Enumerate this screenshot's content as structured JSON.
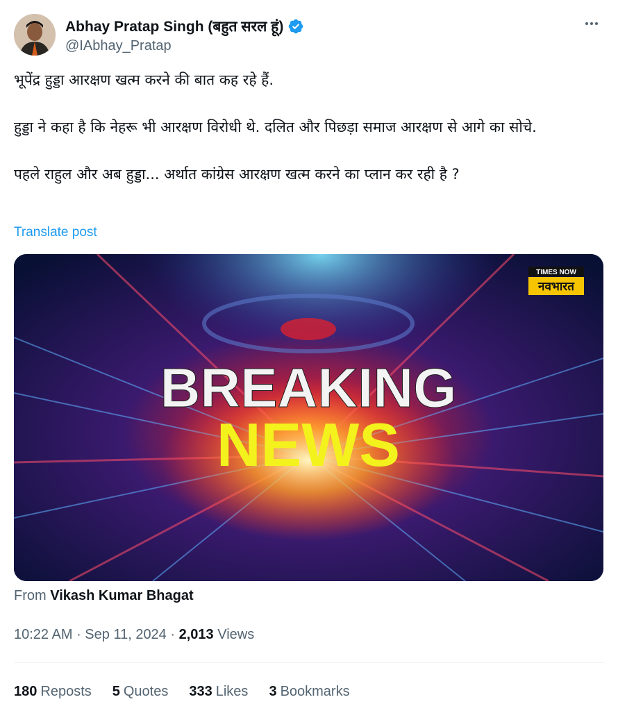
{
  "author": {
    "display_name": "Abhay Pratap Singh (बहुत सरल हूं)",
    "handle": "@IAbhay_Pratap",
    "verified_color": "#1d9bf0"
  },
  "post": {
    "paragraphs": [
      "भूपेंद्र हुड्डा आरक्षण खत्म करने की बात कह रहे हैं.",
      "हुड्डा ने कहा है कि नेहरू भी आरक्षण विरोधी थे. दलित और पिछड़ा समाज आरक्षण से आगे का सोचे.",
      "पहले राहुल और अब हुड्डा... अर्थात कांग्रेस आरक्षण खत्म करने का प्लान कर रही है ?"
    ],
    "translate_label": "Translate post"
  },
  "media": {
    "channel_top": "TIMES NOW",
    "channel_bottom": "नवभारत",
    "headline_line1": "BREAKING",
    "headline_line2": "NEWS"
  },
  "attribution": {
    "prefix": "From",
    "name": "Vikash Kumar Bhagat"
  },
  "meta": {
    "time": "10:22 AM",
    "date": "Sep 11, 2024",
    "views_count": "2,013",
    "views_label": "Views"
  },
  "stats": [
    {
      "count": "180",
      "label": "Reposts"
    },
    {
      "count": "5",
      "label": "Quotes"
    },
    {
      "count": "333",
      "label": "Likes"
    },
    {
      "count": "3",
      "label": "Bookmarks"
    }
  ]
}
